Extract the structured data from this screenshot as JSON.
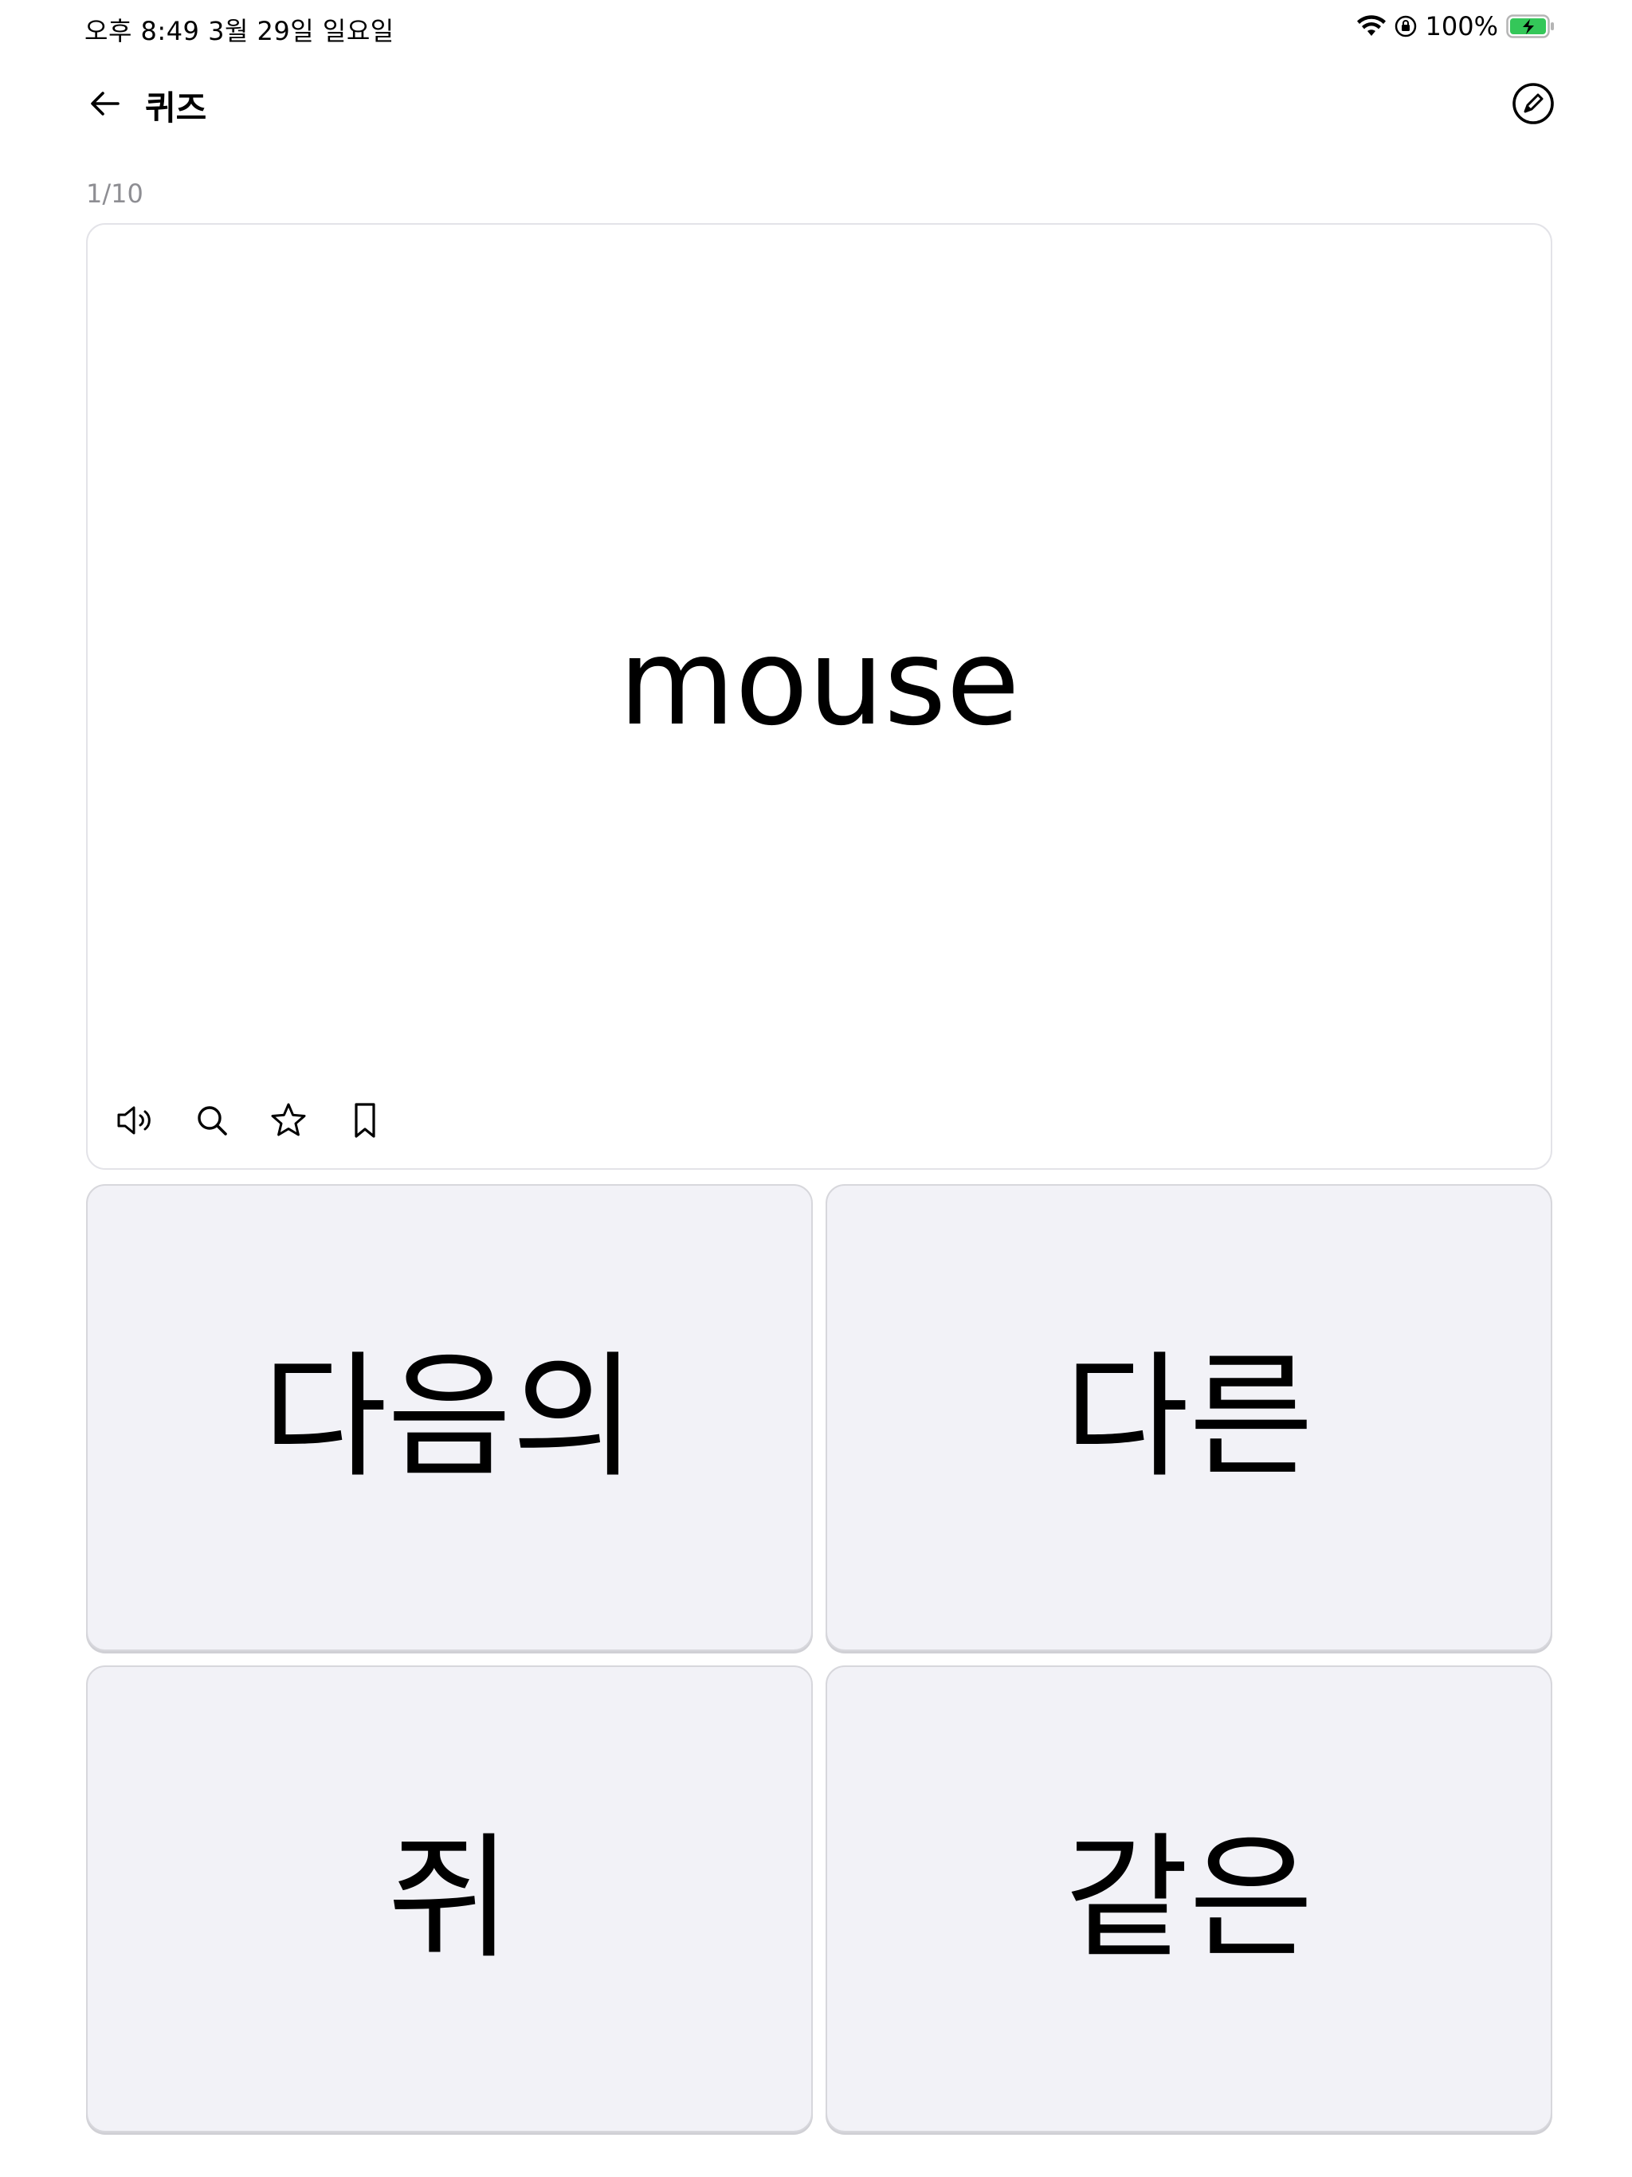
{
  "status_bar": {
    "time": "오후 8:49   3월 29일 일요일",
    "battery": "100%",
    "icons": [
      "wifi-icon",
      "orientation-lock-icon",
      "battery-charging-icon"
    ],
    "battery_color": "#34c759"
  },
  "nav": {
    "title": "퀴즈",
    "back_icon": "arrow-left-icon",
    "edit_icon": "edit-circle-icon"
  },
  "quiz": {
    "progress": "1/10",
    "word": "mouse",
    "tools": [
      "speaker-icon",
      "search-icon",
      "star-icon",
      "bookmark-icon"
    ]
  },
  "answers": [
    {
      "label": "다음의"
    },
    {
      "label": "다른"
    },
    {
      "label": "쥐"
    },
    {
      "label": "같은"
    }
  ],
  "colors": {
    "card_border": "#e3e3e8",
    "answer_bg": "#f2f2f7",
    "muted_text": "#8e8e93"
  }
}
